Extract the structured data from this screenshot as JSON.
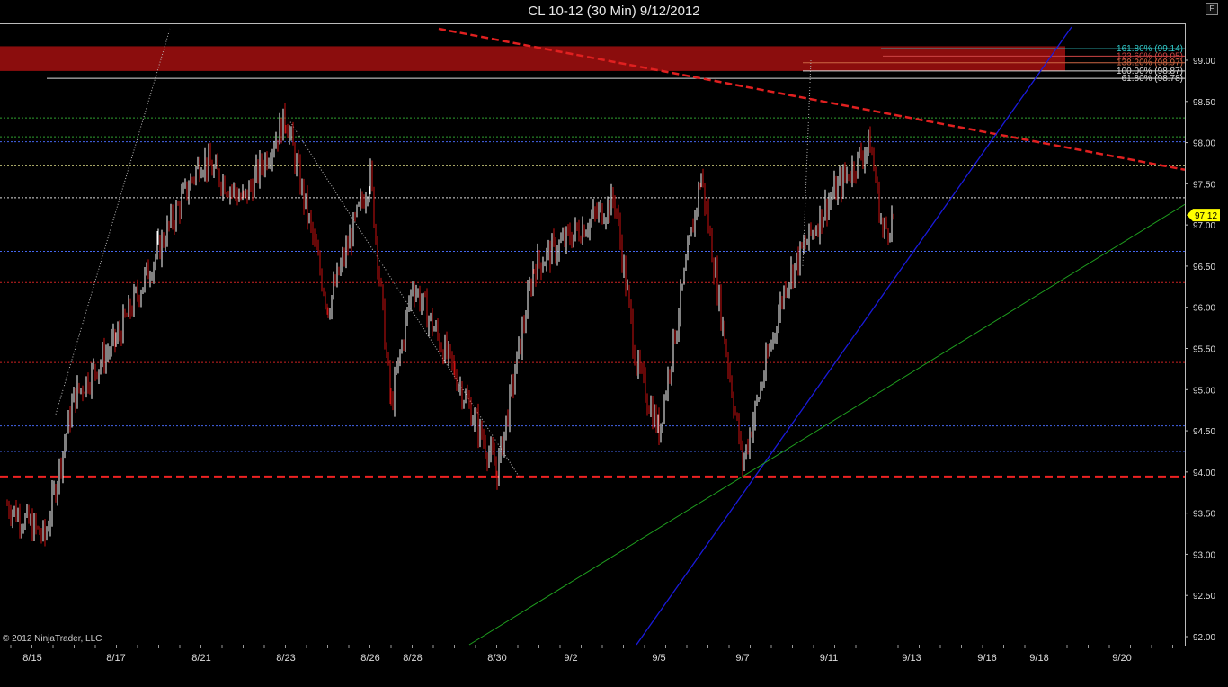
{
  "header": {
    "title": "CL 10-12 (30 Min)  9/12/2012",
    "format_button_label": "F"
  },
  "footer": {
    "copyright": "© 2012 NinjaTrader, LLC"
  },
  "chart_data": {
    "type": "candlestick",
    "title": "CL 10-12 (30 Min)  9/12/2012",
    "instrument": "CL 10-12",
    "interval": "30 Min",
    "date": "9/12/2012",
    "ylim": [
      91.9,
      99.6
    ],
    "y_ticks": [
      "92.00",
      "92.50",
      "93.00",
      "93.50",
      "94.00",
      "94.50",
      "95.00",
      "95.50",
      "96.00",
      "96.50",
      "97.00",
      "97.50",
      "98.00",
      "98.50",
      "99.00"
    ],
    "x_ticks": [
      "8/15",
      "8/17",
      "8/21",
      "8/23",
      "8/26",
      "8/28",
      "8/30",
      "9/2",
      "9/5",
      "9/7",
      "9/11",
      "9/13",
      "9/16",
      "9/18",
      "9/20"
    ],
    "last_price": "97.12",
    "colors": {
      "background": "#000000",
      "up_bar": "#ffffff",
      "down_bar": "#cc1111",
      "last_price_tag": "#ffff00",
      "resistance_zone": "#8b0d0d",
      "trendline_blue": "#1a1adc",
      "trendline_green": "#1fa01f",
      "trendline_red_dashed": "#e02020"
    },
    "fibonacci_levels": [
      {
        "label": "161.80% (99.14)",
        "value": 99.14,
        "color": "#33cccc"
      },
      {
        "label": "123.60% (99.05)",
        "value": 99.05,
        "color": "#cc4444"
      },
      {
        "label": "138.20% (98.97)",
        "value": 98.97,
        "color": "#cc6644"
      },
      {
        "label": "100.00% (98.87)",
        "value": 98.87,
        "color": "#dddddd"
      },
      {
        "label": "61.80% (98.78)",
        "value": 98.78,
        "color": "#dddddd"
      }
    ],
    "horizontal_levels": [
      {
        "value": 98.3,
        "color": "#2fa02f",
        "style": "dotted"
      },
      {
        "value": 98.07,
        "color": "#2fa02f",
        "style": "dotted"
      },
      {
        "value": 98.01,
        "color": "#4466ee",
        "style": "dotted"
      },
      {
        "value": 97.72,
        "color": "#dddd88",
        "style": "dotted"
      },
      {
        "value": 97.33,
        "color": "#dddddd",
        "style": "dotted"
      },
      {
        "value": 96.68,
        "color": "#4466ee",
        "style": "dotted"
      },
      {
        "value": 96.3,
        "color": "#cc2222",
        "style": "dotted"
      },
      {
        "value": 95.33,
        "color": "#cc2222",
        "style": "dotted"
      },
      {
        "value": 94.56,
        "color": "#4466ee",
        "style": "dotted"
      },
      {
        "value": 94.25,
        "color": "#4466ee",
        "style": "dotted"
      },
      {
        "value": 93.94,
        "color": "#ee2222",
        "style": "thick-dashed"
      }
    ],
    "resistance_zone": {
      "from": 98.87,
      "to": 99.17
    },
    "price_path": [
      {
        "x": "8/15",
        "price": 93.6
      },
      {
        "x": "8/15",
        "price": 93.2
      },
      {
        "x": "8/16",
        "price": 94.9
      },
      {
        "x": "8/17",
        "price": 95.6
      },
      {
        "x": "8/20",
        "price": 96.7
      },
      {
        "x": "8/21",
        "price": 97.8
      },
      {
        "x": "8/22",
        "price": 97.3
      },
      {
        "x": "8/23",
        "price": 98.3
      },
      {
        "x": "8/24",
        "price": 96.0
      },
      {
        "x": "8/26",
        "price": 97.6
      },
      {
        "x": "8/27",
        "price": 94.8
      },
      {
        "x": "8/28",
        "price": 96.3
      },
      {
        "x": "8/29",
        "price": 95.2
      },
      {
        "x": "8/30",
        "price": 94.0
      },
      {
        "x": "8/31",
        "price": 96.5
      },
      {
        "x": "9/3",
        "price": 97.3
      },
      {
        "x": "9/4",
        "price": 95.3
      },
      {
        "x": "9/5",
        "price": 94.5
      },
      {
        "x": "9/6",
        "price": 97.6
      },
      {
        "x": "9/7",
        "price": 94.1
      },
      {
        "x": "9/10",
        "price": 96.3
      },
      {
        "x": "9/11",
        "price": 97.3
      },
      {
        "x": "9/12",
        "price": 98.0
      },
      {
        "x": "9/12",
        "price": 96.9
      },
      {
        "x": "9/12",
        "price": 97.12
      }
    ]
  }
}
